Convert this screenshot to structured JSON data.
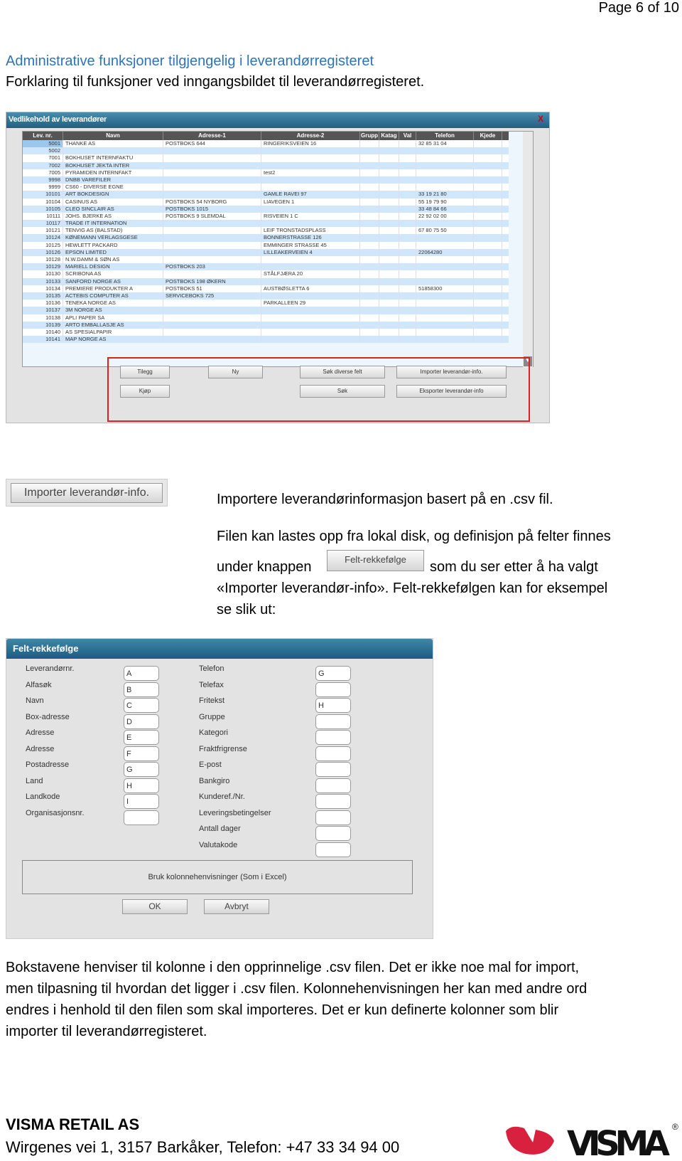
{
  "page_number": "Page 6 of 10",
  "heading": "Administrative funksjoner tilgjengelig i leverandørregisteret",
  "subheading": "Forklaring til funksjoner ved inngangsbildet til leverandørregisteret.",
  "window": {
    "title": "Vedlikehold av leverandører",
    "close": "X",
    "columns": [
      "Lev. nr.",
      "Navn",
      "Adresse-1",
      "Adresse-2",
      "Grupp",
      "Katag",
      "Val",
      "Telefon",
      "Kjede"
    ],
    "rows": [
      [
        "5001",
        "THANKE AS",
        "POSTBOKS 644",
        "RINGERIKSVEIEN 16",
        "32 85 31 04"
      ],
      [
        "5002",
        "",
        "",
        "",
        ""
      ],
      [
        "7001",
        "BOKHUSET INTERNFAKTU",
        "",
        "",
        ""
      ],
      [
        "7002",
        "BOKHUSET JEKTA INTER",
        "",
        "",
        ""
      ],
      [
        "7005",
        "PYRAMIDEN INTERNFAKT",
        "",
        "test2",
        ""
      ],
      [
        "9998",
        "DNBB VAREFILER",
        "",
        "",
        ""
      ],
      [
        "9999",
        "CS60 - DIVERSE EGNE",
        "",
        "",
        ""
      ],
      [
        "10101",
        "ART BOKDESIGN",
        "",
        "GAMLE RAVEI 97",
        "33 19 21 80"
      ],
      [
        "10104",
        "CASINUS AS",
        "POSTBOKS 54 NYBORG",
        "LIAVEGEN 1",
        "55 19 79 90"
      ],
      [
        "10105",
        "CLEO SINCLAIR AS",
        "POSTBOKS 1015",
        "",
        "33 48 84 66"
      ],
      [
        "10111",
        "JOHS. BJERKE AS",
        "POSTBOKS 9 SLEMDAL",
        "RISVEIEN 1 C",
        "22 92 02 00"
      ],
      [
        "10117",
        "TRADE IT INTERNATION",
        "",
        "",
        ""
      ],
      [
        "10121",
        "TENVIG AS (BALSTAD)",
        "",
        "LEIF TRONSTADSPLASS",
        "67 80 75 50"
      ],
      [
        "10124",
        "KØNEMANN VERLAGSGESE",
        "",
        "BONNERSTRASSE 126",
        ""
      ],
      [
        "10125",
        "HEWLETT PACKARD",
        "",
        "EMMINGER STRASSE 45",
        ""
      ],
      [
        "10126",
        "EPSON LIMITED",
        "",
        "LILLEAKERVEIEN 4",
        "22064280"
      ],
      [
        "10128",
        "N.W.DAMM & SØN AS",
        "",
        "",
        ""
      ],
      [
        "10129",
        "MARIELL DESIGN",
        "POSTBOKS 203",
        "",
        ""
      ],
      [
        "10130",
        "SCRIBONA AS",
        "",
        "STÅLFJÆRA 20",
        ""
      ],
      [
        "10133",
        "SANFORD NORGE AS",
        "POSTBOKS 198 ØKERN",
        "",
        ""
      ],
      [
        "10134",
        "PREMIERE PRODUKTER A",
        "POSTBOKS 51",
        "AUSTBØSLETTA 6",
        "51858300"
      ],
      [
        "10135",
        "ACTEBIS COMPUTER AS",
        "SERVICEBOKS 725",
        "",
        ""
      ],
      [
        "10136",
        "TENEKA NORGE AS",
        "",
        "PARKALLEEN 29",
        ""
      ],
      [
        "10137",
        "3M NORGE AS",
        "",
        "",
        ""
      ],
      [
        "10138",
        "APLI PAPER SA",
        "",
        "",
        ""
      ],
      [
        "10139",
        "ARTO EMBALLASJE AS",
        "",
        "",
        ""
      ],
      [
        "10140",
        "AS SPESIALPAPIR",
        "",
        "",
        ""
      ],
      [
        "10141",
        "MAP NORGE AS",
        "",
        "",
        ""
      ]
    ],
    "buttons": {
      "tilegg": "Tilegg",
      "ny": "Ny",
      "sok_diverse": "Søk diverse felt",
      "importer": "Importer leverandør-info.",
      "kjop": "Kjøp",
      "sok": "Søk",
      "eksporter": "Eksporter leverandør-info"
    }
  },
  "import_button": "Importer leverandør-info.",
  "import_text": {
    "line1": "Importere leverandørinformasjon basert på en .csv fil.",
    "line2": "Filen kan lastes opp fra lokal disk, og definisjon på felter finnes",
    "line3a": "under knappen",
    "inline_button": "Felt-rekkefølge",
    "line3b": "som du ser etter å ha valgt",
    "line4": "«Importer leverandør-info». Felt-rekkefølgen kan for eksempel",
    "line5": "se slik ut:"
  },
  "felt": {
    "title": "Felt-rekkefølge",
    "left": [
      [
        "Leverandørnr.",
        "A"
      ],
      [
        "Alfasøk",
        "B"
      ],
      [
        "Navn",
        "C"
      ],
      [
        "Box-adresse",
        "D"
      ],
      [
        "Adresse",
        "E"
      ],
      [
        "Adresse",
        "F"
      ],
      [
        "Postadresse",
        "G"
      ],
      [
        "Land",
        "H"
      ],
      [
        "Landkode",
        "I"
      ],
      [
        "Organisasjonsnr.",
        ""
      ]
    ],
    "right": [
      [
        "Telefon",
        "G"
      ],
      [
        "Telefax",
        ""
      ],
      [
        "Fritekst",
        "H"
      ],
      [
        "Gruppe",
        ""
      ],
      [
        "Kategori",
        ""
      ],
      [
        "Fraktfrigrense",
        ""
      ],
      [
        "E-post",
        ""
      ],
      [
        "Bankgiro",
        ""
      ],
      [
        "Kunderef./Nr.",
        ""
      ],
      [
        "Leveringsbetingelser",
        ""
      ],
      [
        "Antall dager",
        ""
      ],
      [
        "Valutakode",
        ""
      ]
    ],
    "checkbox_label": "Bruk kolonnehenvisninger (Som i Excel)",
    "ok": "OK",
    "cancel": "Avbryt"
  },
  "body_lines": [
    "Bokstavene henviser til kolonne i den opprinnelige .csv filen.  Det er ikke noe mal for import,",
    "men tilpasning til hvordan det ligger i .csv filen. Kolonnehenvisningen her kan med andre ord",
    "endres i henhold til den filen som skal importeres.  Det er kun definerte kolonner som blir",
    "importer til leverandørregisteret."
  ],
  "footer": {
    "company": "VISMA RETAIL AS",
    "address": "Wirgenes vei 1, 3157 Barkåker, Telefon: +47 33 34 94 00",
    "logo": "VISMA"
  },
  "colors": {
    "heading": "#2e74b5",
    "highlight_box": "#e02020",
    "logo_red": "#d8213f"
  }
}
